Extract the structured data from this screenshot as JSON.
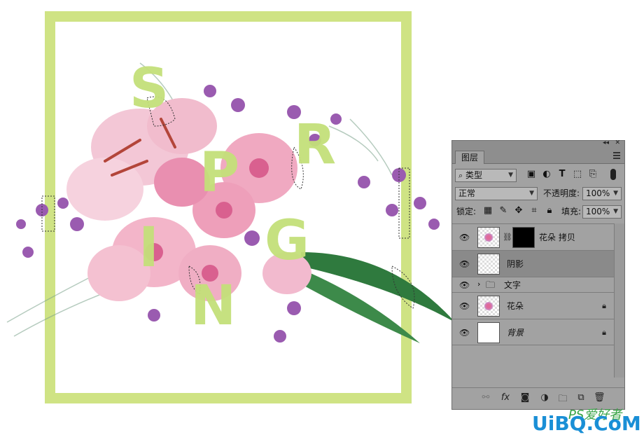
{
  "canvas": {
    "frame_color": "#cfe384",
    "letter_color": "#c4e07a",
    "letters": [
      "S",
      "R",
      "P",
      "G",
      "I",
      "N"
    ]
  },
  "panel": {
    "tab_label": "图层",
    "filter": {
      "value": "类型"
    },
    "blend_mode": {
      "value": "正常"
    },
    "opacity": {
      "label": "不透明度:",
      "value": "100%"
    },
    "lock": {
      "label": "锁定:"
    },
    "fill": {
      "label": "填充:",
      "value": "100%"
    },
    "layers": [
      {
        "name": "花朵 拷贝",
        "visible": true,
        "has_mask": true,
        "locked": false
      },
      {
        "name": "阴影",
        "visible": true,
        "selected": true,
        "locked": false
      },
      {
        "name": "文字",
        "visible": true,
        "type": "group",
        "locked": false
      },
      {
        "name": "花朵",
        "visible": true,
        "locked": true
      },
      {
        "name": "背景",
        "visible": true,
        "locked": true
      }
    ],
    "icons": {
      "filter": [
        "image-filter-icon",
        "adjustment-filter-icon",
        "type-filter-icon",
        "shape-filter-icon",
        "smart-object-filter-icon"
      ],
      "lock": [
        "lock-transparent-icon",
        "lock-pixels-icon",
        "lock-position-icon",
        "lock-artboard-icon",
        "lock-all-icon"
      ],
      "bottom": [
        "link-layers-icon",
        "fx-icon",
        "add-mask-icon",
        "adjustment-layer-icon",
        "new-group-icon",
        "new-layer-icon",
        "delete-layer-icon"
      ]
    }
  },
  "watermark": {
    "top": "PS爱好者",
    "main": "UiBQ.CoM"
  }
}
